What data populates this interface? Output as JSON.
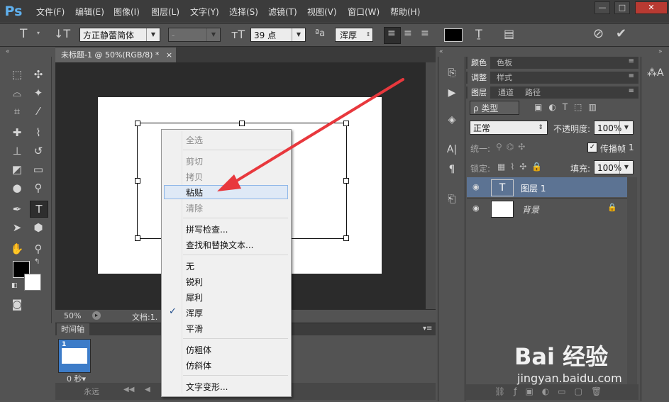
{
  "app": {
    "logo": "Ps"
  },
  "menu": [
    "文件(F)",
    "编辑(E)",
    "图像(I)",
    "图层(L)",
    "文字(Y)",
    "选择(S)",
    "滤镜(T)",
    "视图(V)",
    "窗口(W)",
    "帮助(H)"
  ],
  "window_controls": {
    "minimize": "—",
    "restore": "□",
    "close": "✕"
  },
  "options_bar": {
    "tool_glyph": "T",
    "font_family": "方正静蕾简体",
    "font_style": "-",
    "font_size": "39 点",
    "aa_label": "ªa",
    "antialias": "浑厚",
    "text_color": "#000000"
  },
  "document": {
    "tab_title": "未标题-1 @ 50%(RGB/8) *",
    "tab_close": "×",
    "zoom": "50%",
    "doc_info": "文档:1.",
    "canvas_color": "#ffffff"
  },
  "timeline": {
    "tab_label": "时间轴",
    "frame_number": "1",
    "frame_delay": "0 秒▾",
    "loop": "永远"
  },
  "context_menu": {
    "items": [
      {
        "label": "全选",
        "enabled": false
      },
      {
        "label": "剪切",
        "enabled": false
      },
      {
        "label": "拷贝",
        "enabled": false
      },
      {
        "label": "粘贴",
        "enabled": true,
        "highlighted": true
      },
      {
        "label": "清除",
        "enabled": false
      },
      {
        "label": "拼写检查...",
        "enabled": true
      },
      {
        "label": "查找和替换文本...",
        "enabled": true
      },
      {
        "label": "无",
        "enabled": true
      },
      {
        "label": "锐利",
        "enabled": true
      },
      {
        "label": "犀利",
        "enabled": true
      },
      {
        "label": "浑厚",
        "enabled": true,
        "checked": true
      },
      {
        "label": "平滑",
        "enabled": true
      },
      {
        "label": "仿粗体",
        "enabled": true
      },
      {
        "label": "仿斜体",
        "enabled": true
      },
      {
        "label": "文字变形...",
        "enabled": true
      }
    ],
    "check_mark": "✓"
  },
  "panels": {
    "color_tabs": [
      "颜色",
      "色板"
    ],
    "adjust_tabs": [
      "调整",
      "样式"
    ],
    "layer_tabs": [
      "图层",
      "通道",
      "路径"
    ],
    "filter_kind": "ρ 类型",
    "blend_mode": "正常",
    "opacity_label": "不透明度:",
    "opacity": "100%",
    "unify_label": "统一:",
    "propagate_label": "传播帧",
    "propagate_value": "1",
    "lock_label": "锁定:",
    "fill_label": "填充:",
    "fill": "100%",
    "layers": [
      {
        "name": "图层 1",
        "type": "text",
        "thumb": "T",
        "selected": true
      },
      {
        "name": "背景",
        "type": "background",
        "locked": true,
        "selected": false
      }
    ]
  },
  "watermark": {
    "main": "Bai 经验",
    "sub": "jingyan.baidu.com"
  },
  "colors": {
    "menubar": "#3c3c3c",
    "panel": "#535353",
    "pasteboard": "#2b2b2b",
    "selected_layer": "#5c7393",
    "menu_highlight": "#dfe9f6",
    "annotation_arrow": "#e8383d",
    "foreground": "#000000",
    "background": "#ffffff"
  }
}
